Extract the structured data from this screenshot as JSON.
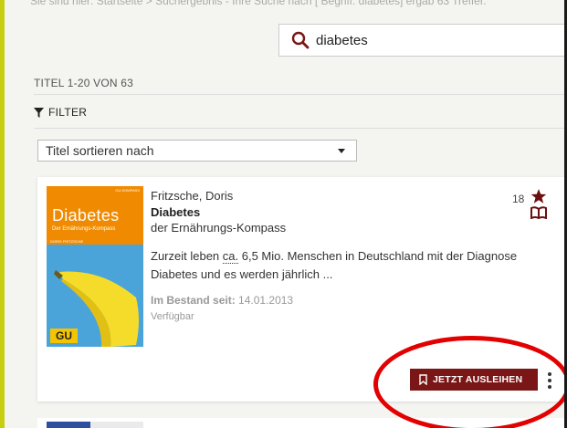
{
  "breadcrumb": "Sie sind hier:   Startseite   >   Suchergebnis - Ihre Suche nach [ Begriff: diabetes] ergab 63 Treffer.",
  "search": {
    "value": "diabetes",
    "placeholder": ""
  },
  "result_count": "TITEL 1-20 VON 63",
  "filter_label": "FILTER",
  "sort_label": "Titel sortieren nach",
  "item": {
    "author": "Fritzsche, Doris",
    "title": "Diabetes",
    "subtitle": "der Ernährungs-Kompass",
    "desc_pre": "Zurzeit leben ",
    "desc_abbr": "ca.",
    "desc_post": " 6,5 Mio. Menschen in Deutschland mit der Diagnose Diabetes und es werden jährlich ...",
    "stock_label": "Im Bestand seit:",
    "stock_date": "14.01.2013",
    "availability": "Verfügbar",
    "rating_count": "18",
    "borrow_label": "JETZT AUSLEIHEN",
    "cover": {
      "series": "GU KOMPASS",
      "title": "Diabetes",
      "subtitle": "Der Ernährungs-Kompass",
      "author": "DORIS FRITZSCHE",
      "publisher": "GU"
    }
  },
  "colors": {
    "accent": "#7a1616",
    "frame": "#c8cf12",
    "annotation": "#e30000"
  },
  "icons": {
    "search": "search-icon",
    "filter": "filter-icon",
    "star": "star-icon",
    "book": "book-icon",
    "bookmark": "bookmark-icon",
    "more": "more-vertical-icon"
  }
}
